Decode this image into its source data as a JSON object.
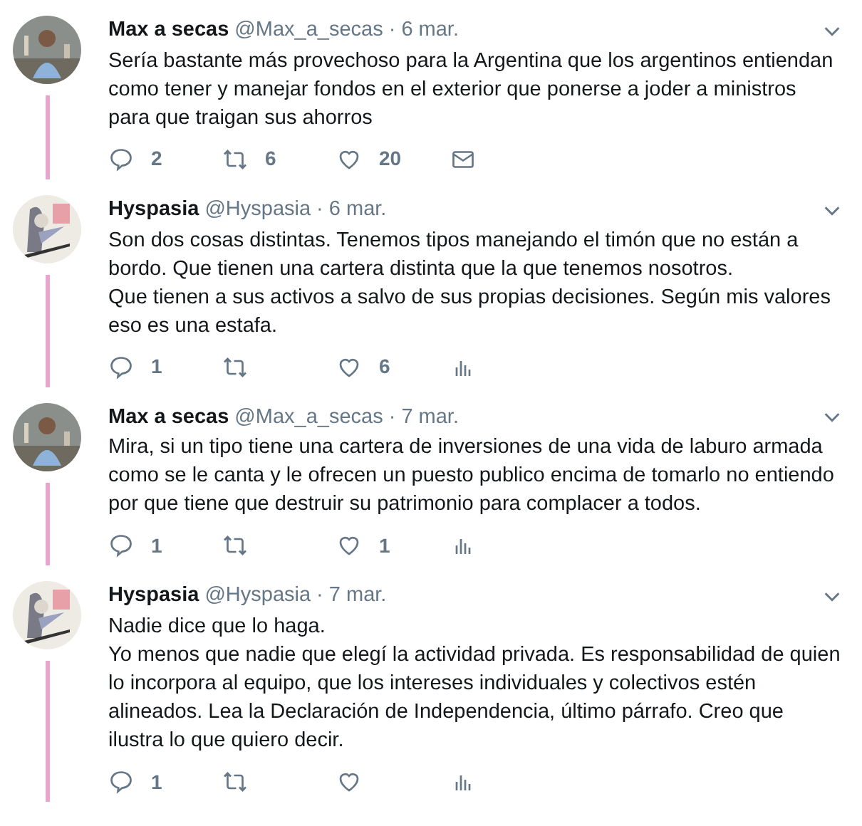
{
  "tweets": [
    {
      "name": "Max a secas",
      "handle": "@Max_a_secas",
      "date": "· 6 mar.",
      "paragraphs": [
        "Sería bastante más provechoso para la Argentina que los argentinos entiendan como tener y manejar fondos en el exterior que ponerse a joder a ministros para que traigan sus ahorros"
      ],
      "replies": "2",
      "retweets": "6",
      "likes": "20",
      "extra_action": {
        "kind": "mail"
      }
    },
    {
      "name": "Hyspasia",
      "handle": "@Hyspasia",
      "date": "· 6 mar.",
      "paragraphs": [
        "Son dos cosas distintas. Tenemos tipos manejando el timón que no están a bordo. Que tienen una cartera distinta que la que tenemos nosotros.",
        "Que tienen a sus activos a salvo de sus propias decisiones. Según mis valores eso es una estafa."
      ],
      "replies": "1",
      "likes": "6",
      "extra_action": {
        "kind": "analytics"
      }
    },
    {
      "name": "Max a secas",
      "handle": "@Max_a_secas",
      "date": "· 7 mar.",
      "paragraphs": [
        "Mira, si un tipo tiene una cartera de inversiones de una vida de laburo armada como se le canta y le ofrecen un puesto publico encima de tomarlo no entiendo por que tiene que destruir su patrimonio para complacer a todos."
      ],
      "replies": "1",
      "likes": "1",
      "extra_action": {
        "kind": "analytics"
      }
    },
    {
      "name": "Hyspasia",
      "handle": "@Hyspasia",
      "date": "· 7 mar.",
      "paragraphs": [
        "Nadie dice que lo haga.",
        "Yo menos que nadie que elegí la actividad privada. Es responsabilidad de quien lo incorpora al equipo, que los intereses individuales y colectivos estén alineados. Lea la Declaración de Independencia, último párrafo. Creo que ilustra lo que quiero decir."
      ],
      "replies": "1",
      "extra_action": {
        "kind": "analytics"
      }
    }
  ]
}
